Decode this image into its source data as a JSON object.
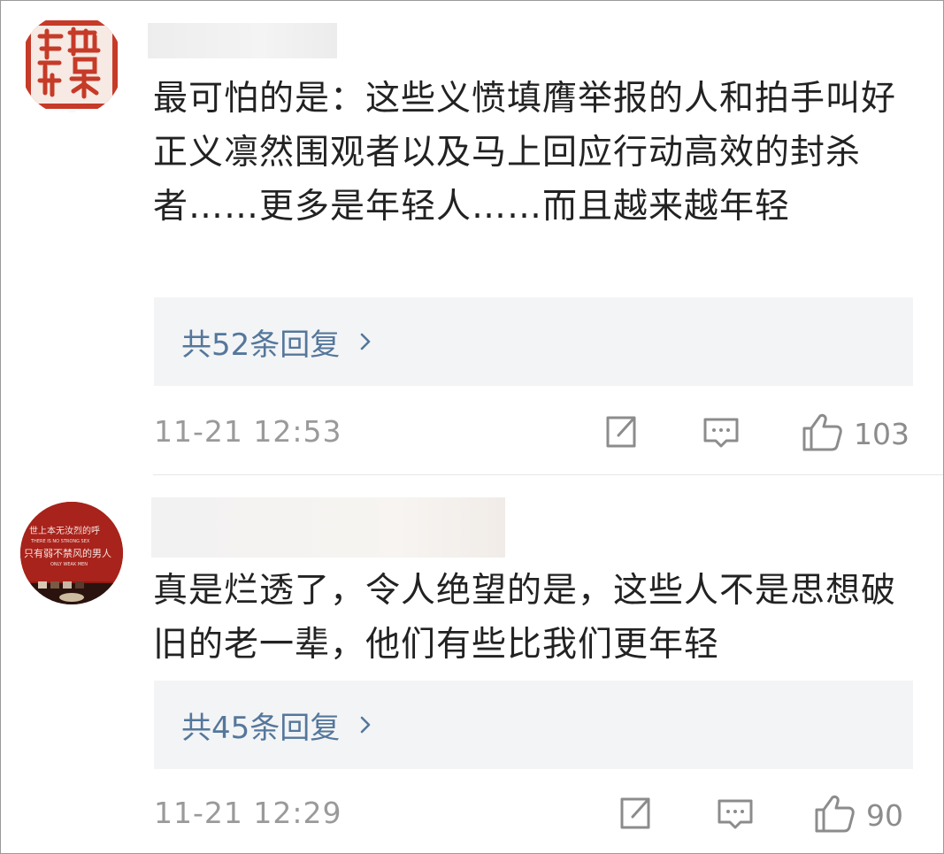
{
  "comments": [
    {
      "text": "最可怕的是：这些义愤填膺举报的人和拍手叫好正义凛然围观者以及马上回应行动高效的封杀者……更多是年轻人……而且越来越年轻",
      "replies_label": "共52条回复",
      "time": "11-21 12:53",
      "likes": "103",
      "avatar_icon": "red-seal-avatar",
      "avatar_seal_text": "兑美常刻"
    },
    {
      "text": "真是烂透了，令人绝望的是，这些人不是思想破旧的老一辈，他们有些比我们更年轻",
      "replies_label": "共45条回复",
      "time": "11-21 12:29",
      "likes": "90",
      "avatar_icon": "red-wall-quote-avatar",
      "avatar_line1": "世上本无汝烈的呼",
      "avatar_line2": "THERE IS NO STRONG SEX",
      "avatar_line3": "只有弱不禁风的男人",
      "avatar_line4": "ONLY WEAK MEN"
    }
  ],
  "icons": {
    "share": "share-icon",
    "comment": "comment-icon",
    "like": "thumbs-up-icon",
    "chevron": "chevron-right-icon"
  },
  "colors": {
    "link": "#55779b",
    "meta": "#9a9a9a",
    "reply_bg": "#f3f4f6",
    "seal_red": "#c63a28"
  }
}
